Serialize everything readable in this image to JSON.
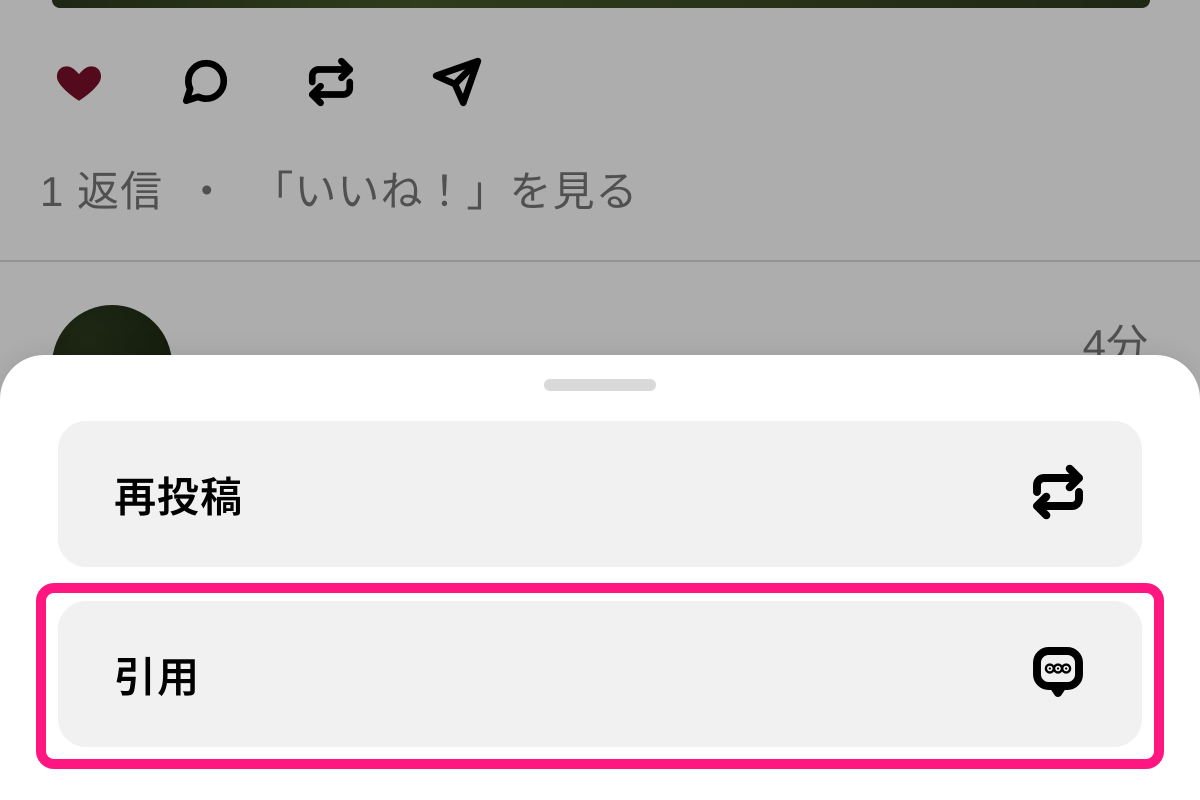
{
  "feed": {
    "reply_count": "1",
    "reply_suffix": " 返信",
    "separator": "・",
    "see_likes": "「いいね！」を見る",
    "next_post_time": "4分"
  },
  "sheet": {
    "repost_label": "再投稿",
    "quote_label": "引用"
  },
  "colors": {
    "highlight": "#ff1681",
    "liked_heart": "#7a0f2a"
  }
}
